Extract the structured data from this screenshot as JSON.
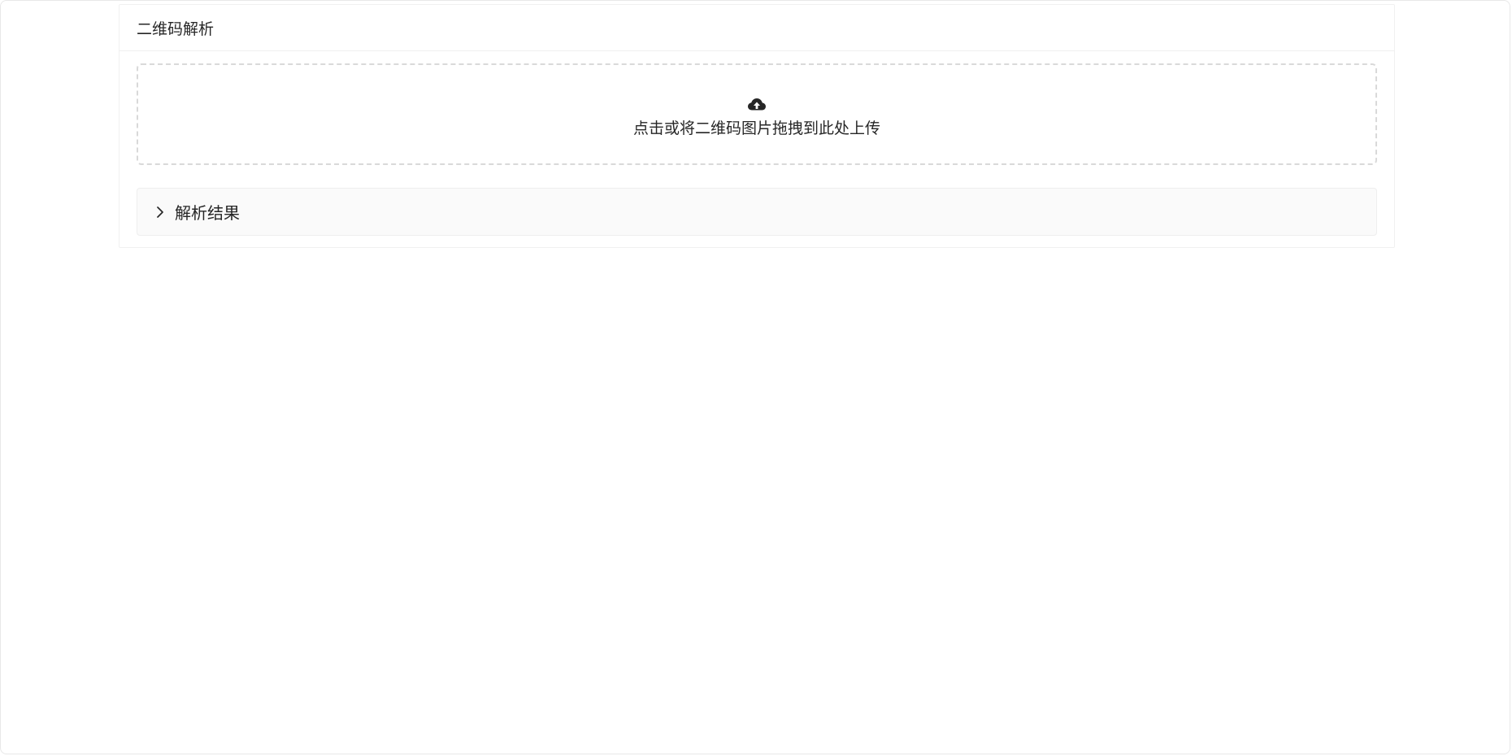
{
  "card": {
    "title": "二维码解析"
  },
  "upload": {
    "icon": "cloud-upload-icon",
    "hint": "点击或将二维码图片拖拽到此处上传"
  },
  "result_panel": {
    "icon": "chevron-right-icon",
    "title": "解析结果",
    "expanded": false
  },
  "colors": {
    "text": "#262626",
    "border": "#f0f0f0",
    "dashed_border": "#d9d9d9",
    "panel_background": "#fafafa"
  }
}
